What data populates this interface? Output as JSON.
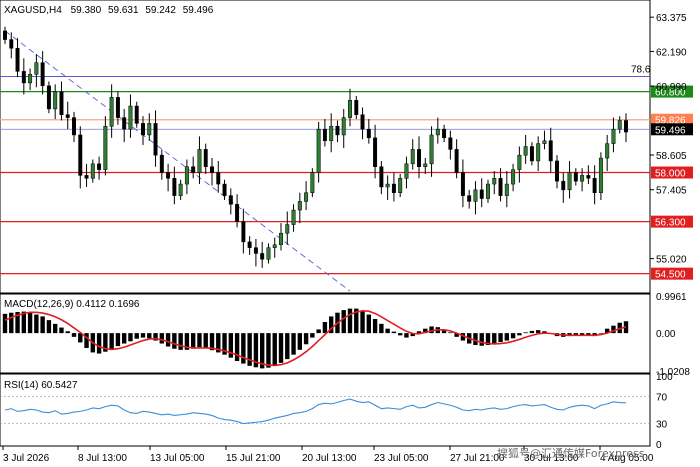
{
  "header": {
    "symbol": "XAGUSD,H4",
    "open": "59.380",
    "high": "59.631",
    "low": "59.242",
    "close": "59.496"
  },
  "watermark": "搜狐号@汇通传媒Forexpress",
  "colors": {
    "bull": "#2e7d32",
    "bear": "#000000",
    "support_line": "#e02020",
    "resistance_green": "#1b8a1b",
    "fib_line": "#4444cc",
    "trend_line": "#5b5bd6",
    "rsi_line": "#3a8fd9",
    "macd_signal": "#e02020",
    "current_price_bg": "#000000",
    "level_59826_bg": "#ff7f50"
  },
  "chart_data": [
    {
      "type": "candlestick",
      "pane": "price",
      "ylim": [
        53.9,
        63.9
      ],
      "y_ticks": [
        "63.375",
        "62.190",
        "60.990",
        "58.605",
        "57.405",
        "55.020"
      ],
      "x_ticks": [
        "3 Jul 2026",
        "8 Jul 13:00",
        "13 Jul 05:00",
        "15 Jul 21:00",
        "20 Jul 13:00",
        "23 Jul 05:00",
        "27 Jul 21:00",
        "30 Jul 13:00",
        "4 Aug 05:00"
      ],
      "closes": [
        62.6,
        62.3,
        61.5,
        61.1,
        61.4,
        61.8,
        61.0,
        60.2,
        60.8,
        60.0,
        59.9,
        59.3,
        57.9,
        57.8,
        58.3,
        58.1,
        59.6,
        60.6,
        59.9,
        59.5,
        60.3,
        59.7,
        59.3,
        59.7,
        58.6,
        58.0,
        57.8,
        57.2,
        57.6,
        58.2,
        58.0,
        58.8,
        58.2,
        58.0,
        57.6,
        57.2,
        56.9,
        56.3,
        55.6,
        55.4,
        55.2,
        55.0,
        55.4,
        55.5,
        55.9,
        56.2,
        56.7,
        57.0,
        57.3,
        58.0,
        59.5,
        59.1,
        59.6,
        59.3,
        59.9,
        60.5,
        60.0,
        59.5,
        59.2,
        58.2,
        57.5,
        57.6,
        57.3,
        57.8,
        58.3,
        58.8,
        58.2,
        58.3,
        59.3,
        59.5,
        59.2,
        58.8,
        58.0,
        57.2,
        57.0,
        57.4,
        57.1,
        57.6,
        57.8,
        57.2,
        57.6,
        58.1,
        58.6,
        58.9,
        58.4,
        59.0,
        59.1,
        58.4,
        57.7,
        57.4,
        58.0,
        57.7,
        57.9,
        57.8,
        57.3,
        58.5,
        59.0,
        59.5,
        59.8,
        59.4
      ],
      "levels": [
        {
          "value": 60.8,
          "label": "60.800",
          "style": "green"
        },
        {
          "value": 59.826,
          "label": "59.826",
          "style": "orange"
        },
        {
          "value": 59.496,
          "label": "59.496",
          "style": "current"
        },
        {
          "value": 58.0,
          "label": "58.000",
          "style": "red"
        },
        {
          "value": 56.3,
          "label": "56.300",
          "style": "red"
        },
        {
          "value": 54.5,
          "label": "54.500",
          "style": "red"
        }
      ],
      "fib_level": {
        "value": 61.32,
        "label": "78.6"
      },
      "trend_line": {
        "from_bar": 0,
        "from_value": 62.9,
        "to_bar": 55,
        "to_value": 53.9
      }
    },
    {
      "type": "histogram",
      "pane": "macd",
      "title": "MACD(12,26,9) 0.4112 0.1696",
      "ylim": [
        -1.02,
        1.0
      ],
      "y_ticks": [
        "0.9961",
        "0.00",
        "-1.0208"
      ],
      "histogram": [
        0.52,
        0.55,
        0.57,
        0.58,
        0.55,
        0.5,
        0.45,
        0.35,
        0.25,
        0.15,
        0.05,
        -0.1,
        -0.25,
        -0.4,
        -0.52,
        -0.55,
        -0.5,
        -0.42,
        -0.35,
        -0.28,
        -0.22,
        -0.15,
        -0.12,
        -0.14,
        -0.2,
        -0.28,
        -0.36,
        -0.42,
        -0.45,
        -0.45,
        -0.42,
        -0.38,
        -0.4,
        -0.46,
        -0.52,
        -0.58,
        -0.66,
        -0.75,
        -0.82,
        -0.88,
        -0.92,
        -0.95,
        -0.93,
        -0.88,
        -0.8,
        -0.7,
        -0.58,
        -0.45,
        -0.3,
        -0.12,
        0.1,
        0.3,
        0.45,
        0.55,
        0.62,
        0.66,
        0.66,
        0.6,
        0.5,
        0.38,
        0.25,
        0.12,
        0.04,
        -0.06,
        -0.12,
        -0.08,
        0.05,
        0.12,
        0.18,
        0.16,
        0.1,
        0.02,
        -0.1,
        -0.2,
        -0.28,
        -0.32,
        -0.34,
        -0.32,
        -0.28,
        -0.24,
        -0.2,
        -0.14,
        -0.06,
        0.02,
        0.06,
        0.08,
        0.05,
        -0.02,
        -0.08,
        -0.1,
        -0.08,
        -0.05,
        -0.05,
        -0.06,
        -0.08,
        0.0,
        0.12,
        0.2,
        0.28,
        0.32
      ],
      "signal": [
        0.35,
        0.42,
        0.48,
        0.53,
        0.56,
        0.56,
        0.54,
        0.5,
        0.44,
        0.36,
        0.26,
        0.14,
        0.02,
        -0.12,
        -0.26,
        -0.36,
        -0.42,
        -0.44,
        -0.42,
        -0.38,
        -0.32,
        -0.26,
        -0.2,
        -0.16,
        -0.15,
        -0.18,
        -0.23,
        -0.29,
        -0.34,
        -0.38,
        -0.4,
        -0.4,
        -0.4,
        -0.41,
        -0.44,
        -0.48,
        -0.53,
        -0.59,
        -0.66,
        -0.72,
        -0.78,
        -0.83,
        -0.86,
        -0.87,
        -0.85,
        -0.8,
        -0.72,
        -0.62,
        -0.5,
        -0.36,
        -0.2,
        -0.04,
        0.12,
        0.27,
        0.4,
        0.5,
        0.57,
        0.6,
        0.59,
        0.53,
        0.44,
        0.34,
        0.24,
        0.14,
        0.05,
        -0.01,
        -0.02,
        0.02,
        0.06,
        0.09,
        0.09,
        0.06,
        0.0,
        -0.07,
        -0.14,
        -0.2,
        -0.25,
        -0.28,
        -0.29,
        -0.28,
        -0.26,
        -0.22,
        -0.17,
        -0.11,
        -0.06,
        -0.02,
        0.0,
        -0.01,
        -0.03,
        -0.05,
        -0.06,
        -0.06,
        -0.06,
        -0.06,
        -0.06,
        -0.04,
        0.0,
        0.06,
        0.12,
        0.17
      ]
    },
    {
      "type": "line",
      "pane": "rsi",
      "title": "RSI(14) 60.5427",
      "ylim": [
        0,
        100
      ],
      "y_ticks": [
        "100",
        "70",
        "30",
        "0"
      ],
      "values": [
        50,
        52,
        48,
        49,
        51,
        50,
        47,
        46,
        49,
        44,
        45,
        47,
        48,
        50,
        53,
        52,
        55,
        57,
        56,
        50,
        46,
        45,
        48,
        47,
        45,
        43,
        44,
        42,
        43,
        44,
        46,
        45,
        44,
        42,
        38,
        36,
        35,
        33,
        30,
        31,
        32,
        33,
        35,
        38,
        40,
        42,
        45,
        46,
        48,
        52,
        58,
        60,
        59,
        61,
        64,
        66,
        63,
        61,
        62,
        57,
        52,
        53,
        52,
        51,
        55,
        57,
        53,
        54,
        58,
        61,
        59,
        57,
        54,
        50,
        49,
        51,
        50,
        52,
        53,
        51,
        52,
        55,
        57,
        58,
        56,
        57,
        58,
        54,
        51,
        50,
        54,
        56,
        57,
        56,
        52,
        57,
        59,
        62,
        61,
        60.5
      ]
    }
  ]
}
